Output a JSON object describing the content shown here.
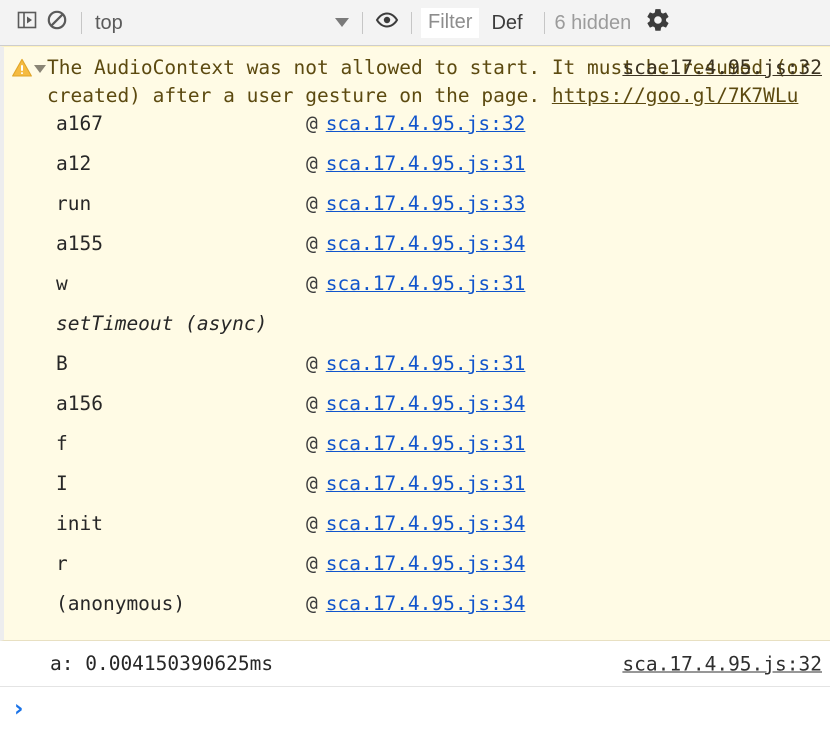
{
  "toolbar": {
    "sidebar_toggle_icon": "console-sidebar-icon",
    "clear_icon": "clear-console-icon",
    "context_label": "top",
    "context_caret_icon": "chevron-down-icon",
    "eye_icon": "live-expression-eye-icon",
    "filter_placeholder": "Filter",
    "levels_label": "Def",
    "hidden_label": "6 hidden",
    "gear_icon": "settings-gear-icon"
  },
  "warning": {
    "icon": "warning-triangle-icon",
    "disclosure_icon": "triangle-down-icon",
    "text_part1": "The AudioContext was not allowed to start. It must be resumed (or created) after a user gesture on the page. ",
    "link_text": "https://goo.gl/7K7WLu",
    "source_link": "sca.17.4.95.js:32",
    "at_symbol": "@",
    "stack": [
      {
        "fn": "a167",
        "link": "sca.17.4.95.js:32",
        "async": false
      },
      {
        "fn": "a12",
        "link": "sca.17.4.95.js:31",
        "async": false
      },
      {
        "fn": "run",
        "link": "sca.17.4.95.js:33",
        "async": false
      },
      {
        "fn": "a155",
        "link": "sca.17.4.95.js:34",
        "async": false
      },
      {
        "fn": "w",
        "link": "sca.17.4.95.js:31",
        "async": false
      },
      {
        "fn": "setTimeout (async)",
        "link": "",
        "async": true
      },
      {
        "fn": "B",
        "link": "sca.17.4.95.js:31",
        "async": false
      },
      {
        "fn": "a156",
        "link": "sca.17.4.95.js:34",
        "async": false
      },
      {
        "fn": "f",
        "link": "sca.17.4.95.js:31",
        "async": false
      },
      {
        "fn": "I",
        "link": "sca.17.4.95.js:31",
        "async": false
      },
      {
        "fn": "init",
        "link": "sca.17.4.95.js:34",
        "async": false
      },
      {
        "fn": "r",
        "link": "sca.17.4.95.js:34",
        "async": false
      },
      {
        "fn": "(anonymous)",
        "link": "sca.17.4.95.js:34",
        "async": false
      }
    ]
  },
  "timing": {
    "text": "a: 0.004150390625ms",
    "source_link": "sca.17.4.95.js:32"
  },
  "prompt": {
    "arrow": "›"
  },
  "colors": {
    "warning_bg": "#fffbe5",
    "warning_text": "#5c4a10",
    "link_blue": "#1155cc",
    "prompt_blue": "#1a73e8",
    "toolbar_bg": "#f3f3f3"
  }
}
